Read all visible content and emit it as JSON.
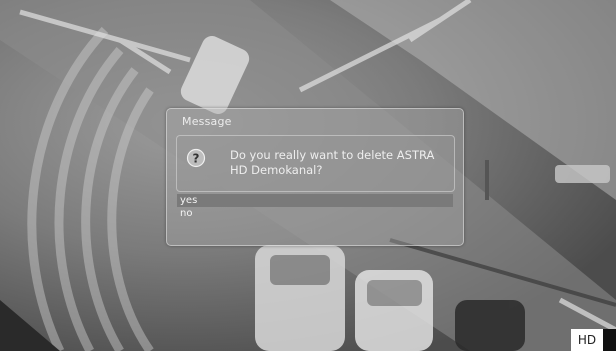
{
  "dialog": {
    "title": "Message",
    "icon": "question-icon",
    "message": "Do you really want to delete ASTRA HD Demokanal?",
    "options": [
      {
        "label": "yes",
        "selected": true
      },
      {
        "label": "no",
        "selected": false
      }
    ]
  },
  "badge": {
    "label": "HD"
  },
  "colors": {
    "selection": "#7a7a7a",
    "text": "#eeeeee"
  }
}
